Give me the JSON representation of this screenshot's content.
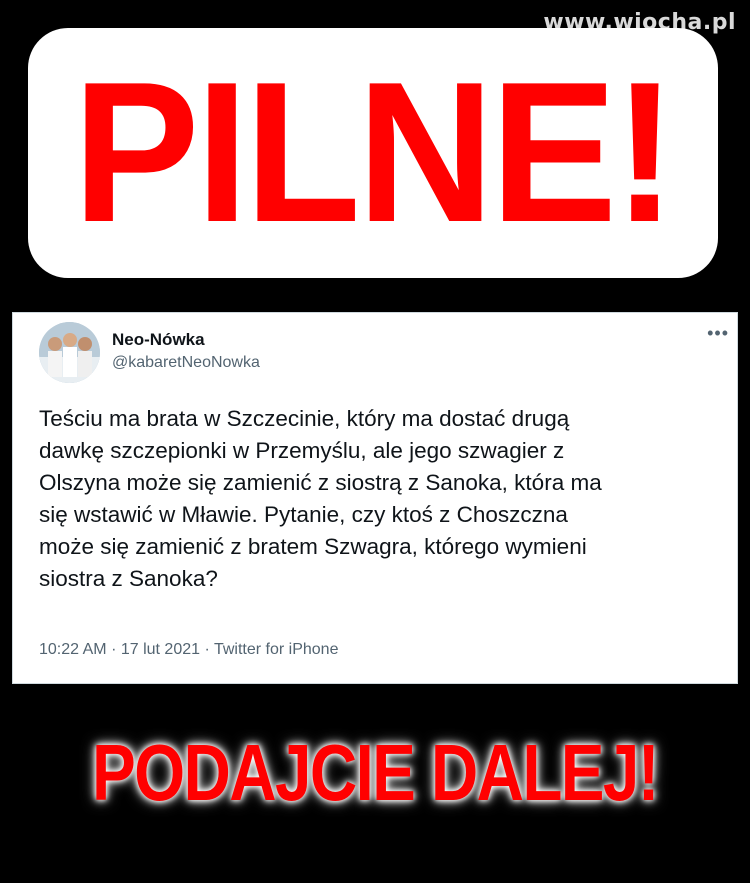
{
  "watermark": "www.wiocha.pl",
  "headline": "PILNE!",
  "tweet": {
    "author_name": "Neo-Nówka",
    "author_handle": "@kabaretNeoNowka",
    "more_icon": "more-dots-icon",
    "text": "Teściu ma brata w Szczecinie, który ma dostać drugą\ndawkę szczepionki w Przemyślu, ale jego szwagier z\nOlszyna może się zamienić z siostrą z Sanoka, która ma\nsię wstawić w Mławie. Pytanie, czy ktoś z Choszczna\nmoże się zamienić z bratem Szwagra, którego wymieni\nsiostra z Sanoka?",
    "time": "10:22 AM",
    "date": "17 lut 2021",
    "source": "Twitter for iPhone"
  },
  "footer": "PODAJCIE DALEJ!",
  "colors": {
    "accent_red": "#ff0000",
    "background": "#000000",
    "tweet_text": "#0f1419",
    "tweet_meta": "#536471"
  }
}
